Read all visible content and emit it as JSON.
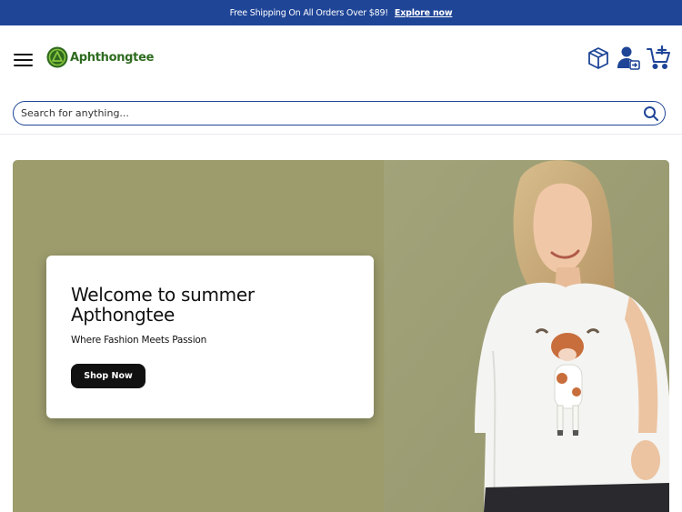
{
  "promo": {
    "text": "Free Shipping On All Orders Over $89!",
    "link_label": "Explore now"
  },
  "brand": {
    "name": "Aphthongtee",
    "logo_color": "#2e6b1f",
    "accent_color": "#1f4597"
  },
  "header": {
    "icons": [
      "box-icon",
      "account-icon",
      "cart-icon"
    ]
  },
  "search": {
    "placeholder": "Search for anything..."
  },
  "hero": {
    "background_color": "#9c9c6d",
    "title": "Welcome to summer Apthongtee",
    "subtitle": "Where Fashion Meets Passion",
    "cta_label": "Shop Now"
  }
}
